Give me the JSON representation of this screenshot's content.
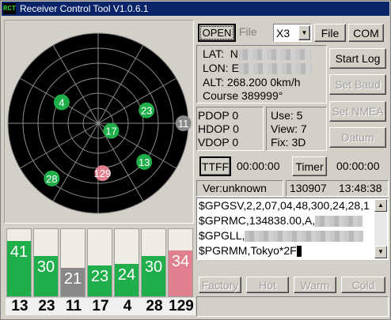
{
  "window": {
    "icon_text": "RCT",
    "title": "Receiver Control Tool V1.0.6.1"
  },
  "toolbar": {
    "open_label": "OPEN",
    "file_field_label": "File",
    "port_value": "X3",
    "file_button": "File",
    "com_button": "COM"
  },
  "position": {
    "lat_label": "LAT:",
    "lat_value": "N",
    "lon_label": "LON:",
    "lon_value": "E",
    "alt_label": "ALT:",
    "alt_value": "268.200",
    "speed_unit": "0km/h",
    "course_label": "Course",
    "course_value": "389999°"
  },
  "dop": {
    "pdop": "PDOP 0",
    "hdop": "HDOP 0",
    "vdop": "VDOP 0"
  },
  "sats": {
    "use": "Use: 5",
    "view": "View: 7",
    "fix": "Fix: 3D"
  },
  "side_buttons": {
    "start_log": "Start Log",
    "set_baud": "Set Baud",
    "set_nmea": "Set NMEA",
    "datum": "Datum"
  },
  "timers": {
    "ttff_label": "TTFF",
    "ttff_value": "00:00:00",
    "timer_label": "Timer",
    "timer_value": "00:00:00"
  },
  "info": {
    "version": "Ver:unknown",
    "date": "130907",
    "time": "13:48:38"
  },
  "nmea_lines": [
    "$GPGSV,2,2,07,04,48,300,24,28,1",
    "$GPRMC,134838.00,A,",
    "$GPGLL,",
    "$PGRMM,Tokyo*2F"
  ],
  "reset_buttons": {
    "factory": "Factory",
    "hot": "Hot",
    "warm": "Warm",
    "cold": "Cold"
  },
  "colors": {
    "used": "#1fae4a",
    "weak": "#888888",
    "unused": "#e0808e",
    "radar_bg": "#000000",
    "ring": "#8a8a8a"
  },
  "radar_sats": [
    {
      "prn": "4",
      "elevation": 48,
      "azimuth": 300,
      "state": "used"
    },
    {
      "prn": "17",
      "elevation": 75,
      "azimuth": 120,
      "state": "used"
    },
    {
      "prn": "23",
      "elevation": 40,
      "azimuth": 75,
      "state": "used"
    },
    {
      "prn": "11",
      "elevation": 5,
      "azimuth": 90,
      "state": "weak"
    },
    {
      "prn": "13",
      "elevation": 30,
      "azimuth": 130,
      "state": "used"
    },
    {
      "prn": "129",
      "elevation": 40,
      "azimuth": 175,
      "state": "unused"
    },
    {
      "prn": "28",
      "elevation": 18,
      "azimuth": 220,
      "state": "used"
    }
  ],
  "snr_bars": [
    {
      "prn": "13",
      "snr": "41",
      "level": 0.82,
      "state": "used"
    },
    {
      "prn": "23",
      "snr": "30",
      "level": 0.6,
      "state": "used"
    },
    {
      "prn": "11",
      "snr": "21",
      "level": 0.42,
      "state": "weak"
    },
    {
      "prn": "17",
      "snr": "23",
      "level": 0.46,
      "state": "used"
    },
    {
      "prn": "4",
      "snr": "24",
      "level": 0.48,
      "state": "used"
    },
    {
      "prn": "28",
      "snr": "30",
      "level": 0.6,
      "state": "used"
    },
    {
      "prn": "129",
      "snr": "34",
      "level": 0.68,
      "state": "unused"
    }
  ]
}
